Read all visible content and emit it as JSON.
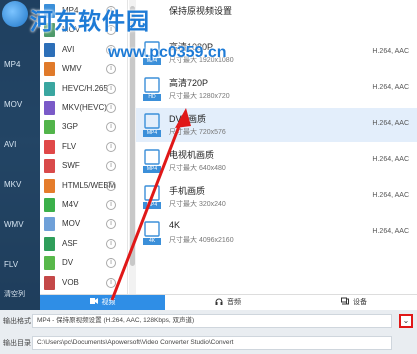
{
  "watermark": {
    "title": "河东软件园",
    "url": "www.pc0359.cn"
  },
  "background": {
    "lines": [
      "MP4",
      "MOV",
      "AVI",
      "MKV",
      "WMV",
      "FLV"
    ],
    "side_label": "清空列"
  },
  "formats": [
    {
      "name": "MP4",
      "color": "#3b8fd9"
    },
    {
      "name": "MOV",
      "color": "#4e9a6a"
    },
    {
      "name": "AVI",
      "color": "#2d6fb8"
    },
    {
      "name": "WMV",
      "color": "#e07a2a"
    },
    {
      "name": "HEVC/H.265",
      "color": "#3aa6a0"
    },
    {
      "name": "MKV(HEVC)",
      "color": "#7a5ac8"
    },
    {
      "name": "3GP",
      "color": "#52b44a"
    },
    {
      "name": "FLV",
      "color": "#e04848"
    },
    {
      "name": "SWF",
      "color": "#d94a4a"
    },
    {
      "name": "HTML5/WEBM",
      "color": "#e57c2b"
    },
    {
      "name": "M4V",
      "color": "#3bb04a"
    },
    {
      "name": "MOV",
      "color": "#6fa0d8"
    },
    {
      "name": "ASF",
      "color": "#2f9e5a"
    },
    {
      "name": "DV",
      "color": "#58b84a"
    },
    {
      "name": "VOB",
      "color": "#c44848"
    }
  ],
  "info_glyph": "i",
  "qualities": [
    {
      "name": "保持原视频设置",
      "size": "",
      "codec": "",
      "badge": ""
    },
    {
      "name": "高清1080P",
      "size": "尺寸最大 1920x1080",
      "codec": "H.264, AAC",
      "badge": "MP4"
    },
    {
      "name": "高清720P",
      "size": "尺寸最大 1280x720",
      "codec": "H.264, AAC",
      "badge": "HD"
    },
    {
      "name": "DVD画质",
      "size": "尺寸最大 720x576",
      "codec": "H.264, AAC",
      "badge": "MP4"
    },
    {
      "name": "电视机画质",
      "size": "尺寸最大 640x480",
      "codec": "H.264, AAC",
      "badge": "MP4"
    },
    {
      "name": "手机画质",
      "size": "尺寸最大 320x240",
      "codec": "H.264, AAC",
      "badge": "MP4"
    },
    {
      "name": "4K",
      "size": "尺寸最大 4096x2160",
      "codec": "H.264, AAC",
      "badge": "4K"
    }
  ],
  "tabs": [
    {
      "label": "视频",
      "active": true
    },
    {
      "label": "音频",
      "active": false
    },
    {
      "label": "设备",
      "active": false
    }
  ],
  "output_format": {
    "label": "输出格式：",
    "value": "MP4 - 保持原视频设置 (H.264, AAC, 128Kbps, 双声道)",
    "dropdown_glyph": "⌄"
  },
  "output_dir": {
    "label": "输出目录：",
    "value": "C:\\Users\\pc\\Documents\\Apowersoft\\Video Converter Studio\\Convert"
  },
  "colors": {
    "accent": "#2f8ee6",
    "selected_row": "#e3eefb",
    "highlight_border": "#e01818",
    "annotation_arrow": "#e01818"
  }
}
